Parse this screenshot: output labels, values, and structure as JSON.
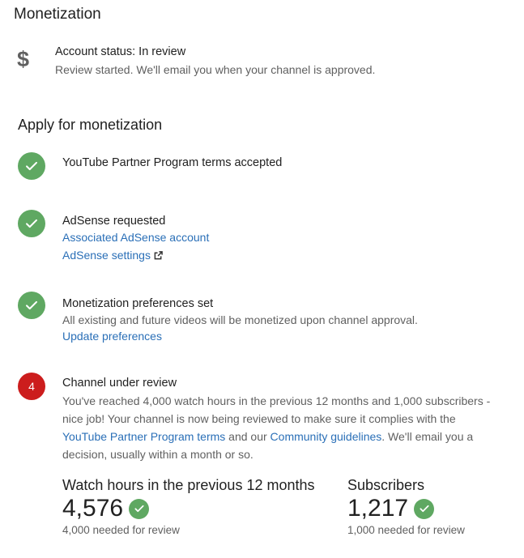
{
  "page": {
    "title": "Monetization"
  },
  "account": {
    "status": "Account status: In review",
    "message": "Review started. We'll email you when your channel is approved."
  },
  "apply": {
    "heading": "Apply for monetization",
    "steps": [
      {
        "state": "done",
        "title": "YouTube Partner Program terms accepted"
      },
      {
        "state": "done",
        "title": "AdSense requested",
        "link1": "Associated AdSense account",
        "link2": "AdSense settings"
      },
      {
        "state": "done",
        "title": "Monetization preferences set",
        "text": "All existing and future videos will be monetized upon channel approval.",
        "link": "Update preferences"
      },
      {
        "state": "in-review",
        "number": "4",
        "title": "Channel under review",
        "desc_part1": "You've reached 4,000 watch hours in the previous 12 months and 1,000 subscribers - nice job! Your channel is now being reviewed to make sure it complies with the ",
        "link_terms": "YouTube Partner Program terms",
        "desc_part2": " and our ",
        "link_guidelines": "Community guidelines",
        "desc_part3": ". We'll email you a decision, usually within a month or so."
      }
    ]
  },
  "metrics": {
    "watch": {
      "label": "Watch hours in the previous 12 months",
      "value": "4,576",
      "note": "4,000 needed for review"
    },
    "subs": {
      "label": "Subscribers",
      "value": "1,217",
      "note": "1,000 needed for review"
    }
  },
  "colors": {
    "check_green": "#5fa862",
    "step_red": "#cc1d1d",
    "link_blue": "#2a6fb7"
  }
}
